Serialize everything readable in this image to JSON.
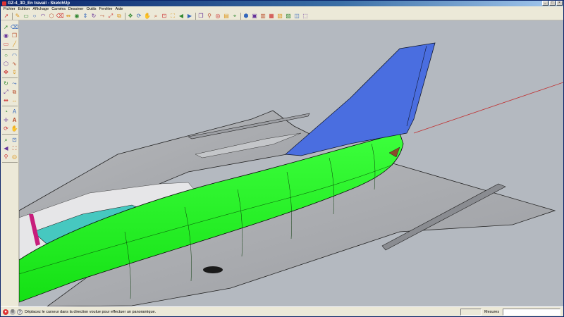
{
  "window": {
    "title": "GZ-4_3D_En travail - SketchUp"
  },
  "menubar": {
    "items": [
      "Fichier",
      "Edition",
      "Affichage",
      "Caméra",
      "Dessiner",
      "Outils",
      "Fenêtre",
      "Aide"
    ]
  },
  "toolbar_top": {
    "icons": [
      "select-arrow-icon",
      "pencil-icon",
      "rectangle-icon",
      "circle-icon",
      "arc-icon",
      "polygon-icon",
      "eraser-icon",
      "tape-measure-icon",
      "paint-bucket-icon",
      "push-pull-icon",
      "rotate-icon",
      "follow-me-icon",
      "scale-icon",
      "offset-icon",
      "move-icon",
      "orbit-icon",
      "pan-icon",
      "zoom-icon",
      "zoom-window-icon",
      "zoom-extents-icon",
      "previous-view-icon",
      "next-view-icon",
      "component-icon",
      "walk-icon",
      "look-around-icon",
      "section-plane-icon",
      "position-camera-icon",
      "iso-view-icon",
      "top-view-icon",
      "front-view-icon",
      "right-view-icon",
      "back-view-icon",
      "left-view-icon",
      "xray-icon",
      "wireframe-icon"
    ]
  },
  "toolbar_left": {
    "icons": [
      "select-arrow-icon",
      "eraser-icon",
      "paint-bucket-icon",
      "component-icon",
      "rectangle-icon",
      "line-icon",
      "circle-icon",
      "arc-icon",
      "polygon-icon",
      "freehand-icon",
      "move-icon",
      "push-pull-icon",
      "rotate-icon",
      "follow-me-icon",
      "scale-icon",
      "offset-icon",
      "tape-measure-icon",
      "dimension-icon",
      "protractor-icon",
      "text-icon",
      "axes-icon",
      "3d-text-icon",
      "orbit-icon",
      "pan-icon",
      "zoom-icon",
      "zoom-window-icon",
      "previous-view-icon",
      "zoom-extents-icon",
      "walk-icon",
      "look-around-icon"
    ]
  },
  "statusbar": {
    "message": "Déplacez le curseur dans la direction voulue pour effectuer un panoramique.",
    "measure_label": "Mesures",
    "measure_value": ""
  },
  "colors": {
    "fuselage": "#22ee22",
    "wing": "#a7a9ad",
    "tail": "#4a6ee0",
    "canopy": "#46c8c0",
    "viewport_bg": "#b4b9c0"
  }
}
